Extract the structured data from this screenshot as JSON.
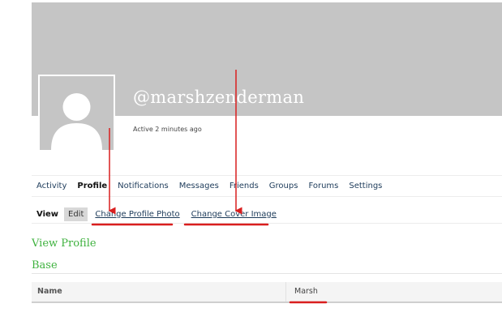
{
  "profile": {
    "handle": "@marshzenderman",
    "activity_status": "Active 2 minutes ago"
  },
  "main_nav": {
    "items": [
      {
        "label": "Activity",
        "active": false
      },
      {
        "label": "Profile",
        "active": true
      },
      {
        "label": "Notifications",
        "active": false
      },
      {
        "label": "Messages",
        "active": false
      },
      {
        "label": "Friends",
        "active": false
      },
      {
        "label": "Groups",
        "active": false
      },
      {
        "label": "Forums",
        "active": false
      },
      {
        "label": "Settings",
        "active": false
      }
    ]
  },
  "sub_nav": {
    "items": [
      {
        "label": "View"
      },
      {
        "label": "Edit"
      },
      {
        "label": "Change Profile Photo"
      },
      {
        "label": "Change Cover Image"
      }
    ]
  },
  "sections": {
    "view_profile": "View Profile",
    "base": "Base"
  },
  "fields": {
    "name_label": "Name",
    "name_value": "Marsh"
  },
  "colors": {
    "cover": "#c5c5c5",
    "heading_green": "#3fb23f",
    "annotation_red": "#d91e1e",
    "link_blue": "#1d3b5a"
  },
  "icons": {
    "avatar": "default-user-silhouette-icon"
  }
}
